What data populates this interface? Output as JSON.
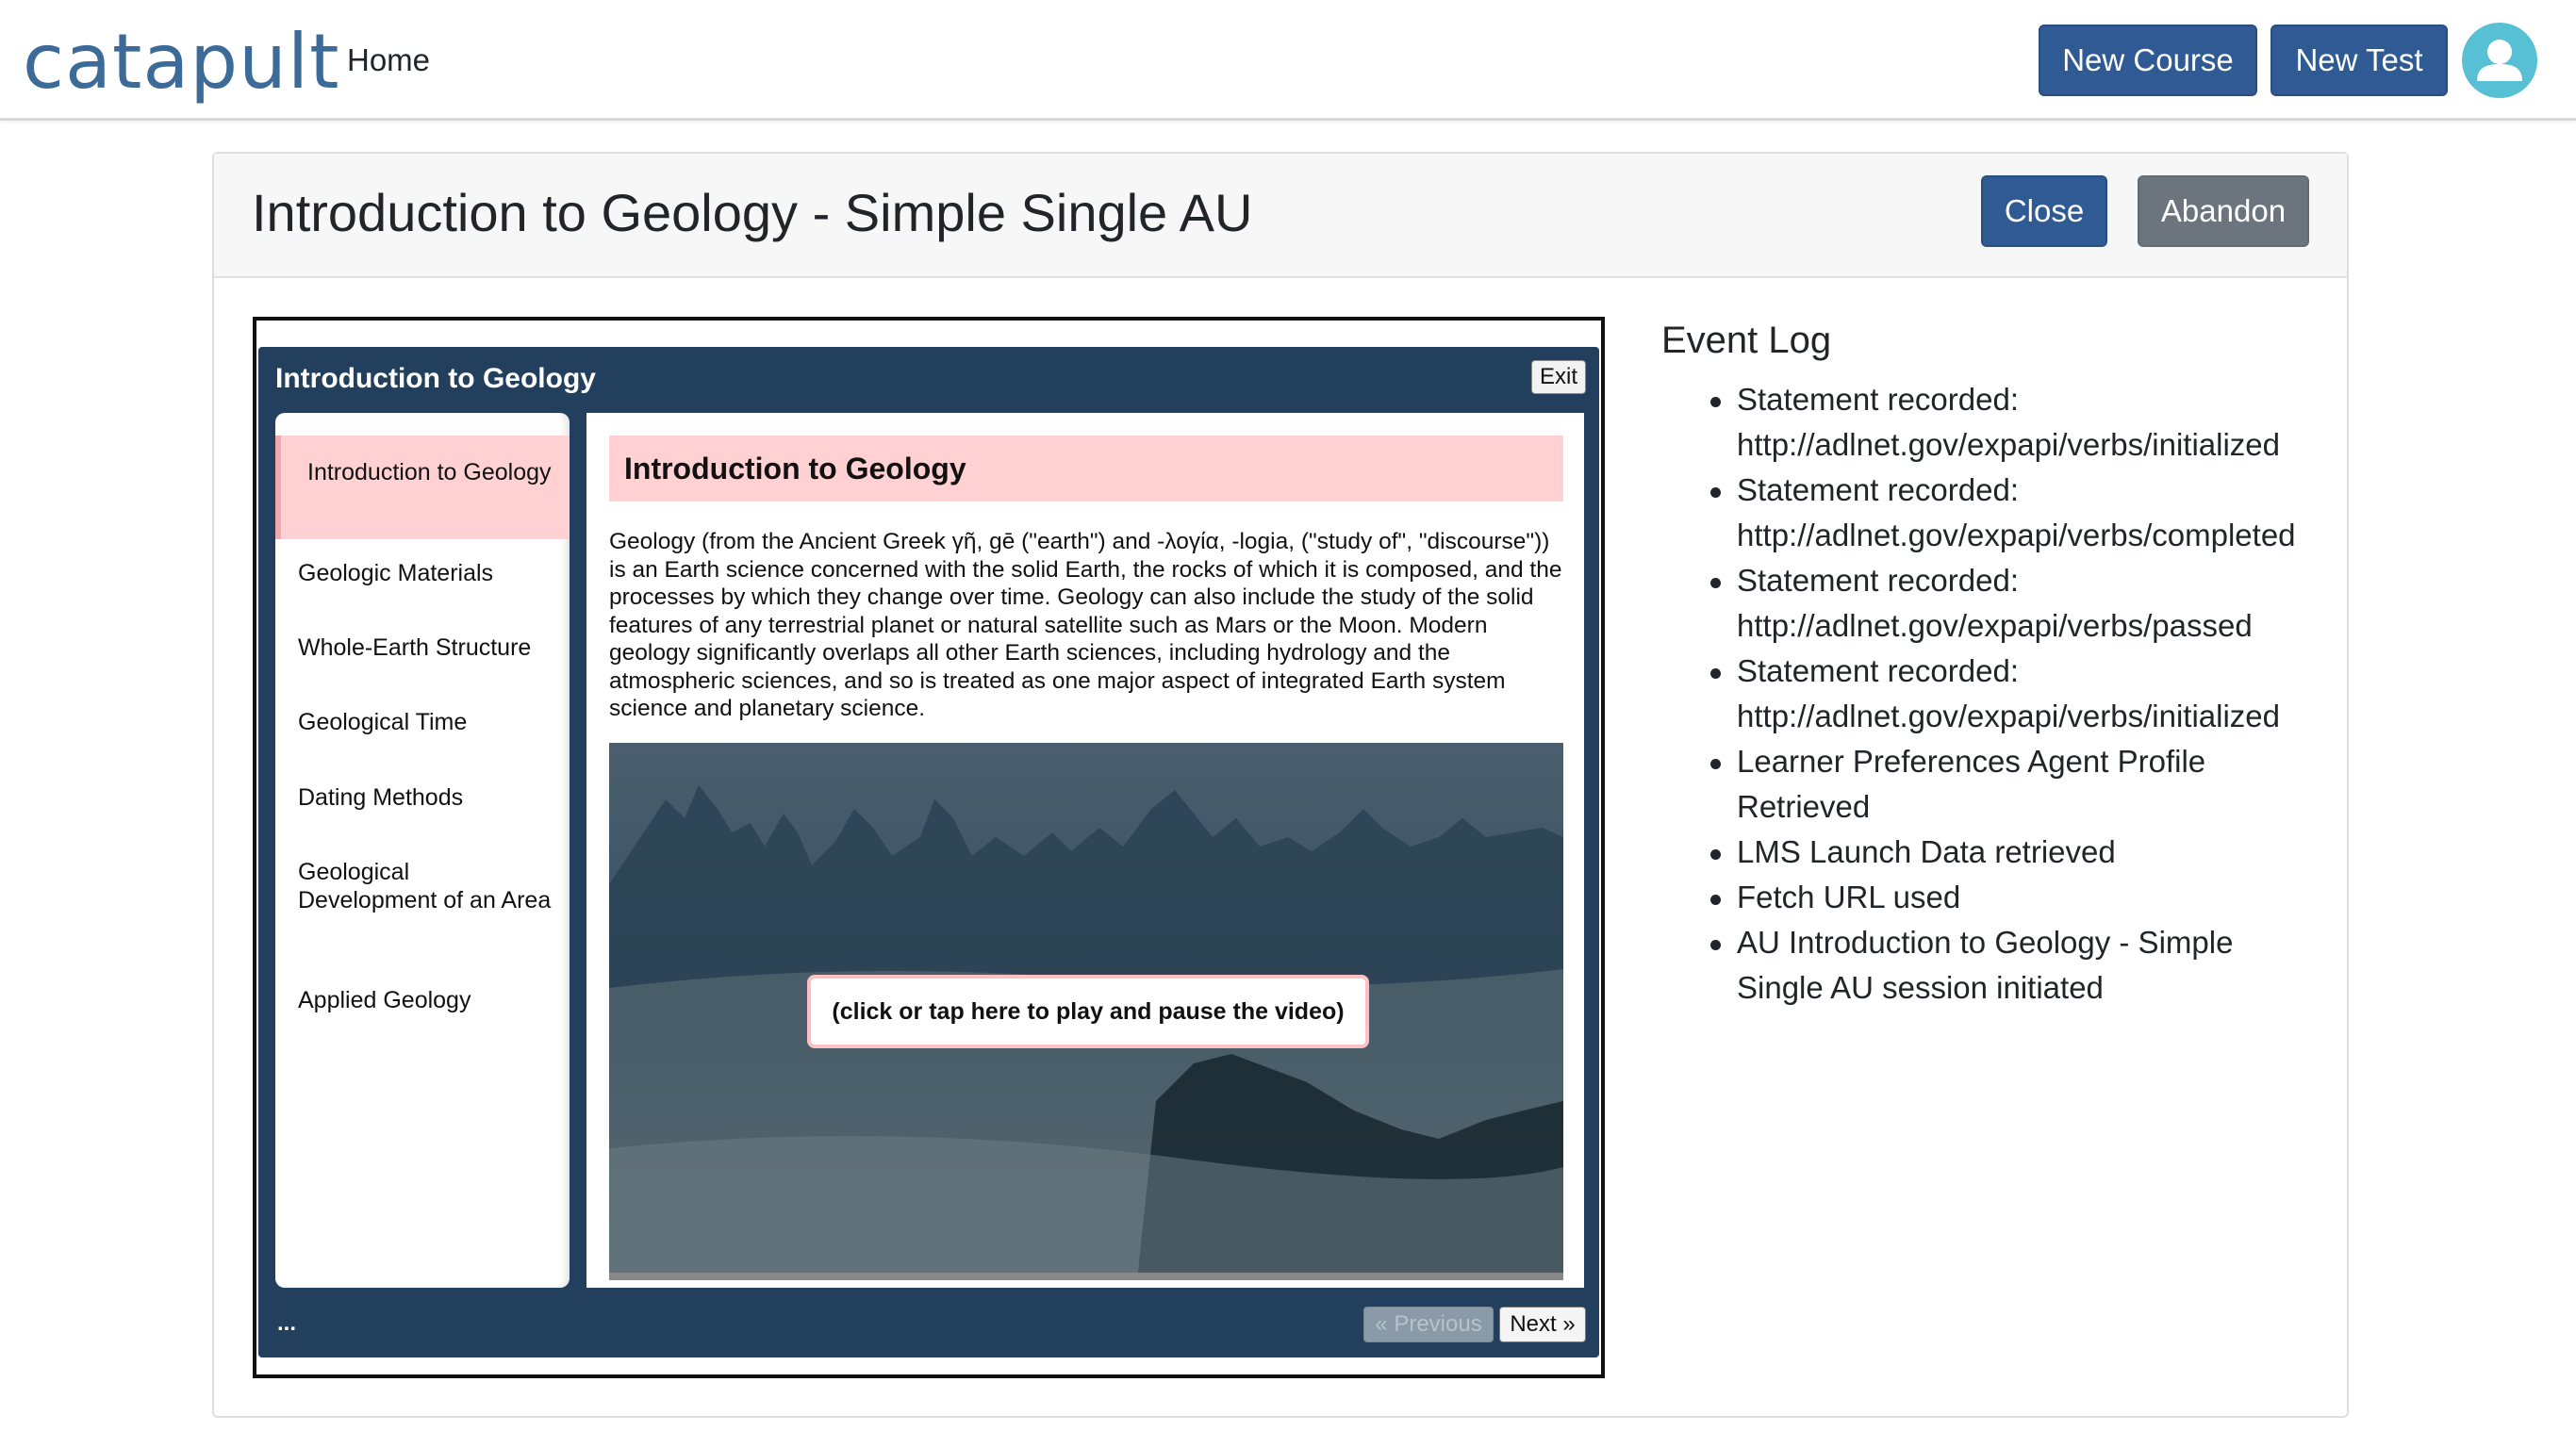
{
  "nav": {
    "brand": "catapult",
    "home_label": "Home",
    "new_course_label": "New Course",
    "new_test_label": "New Test",
    "avatar_icon": "user-avatar-icon"
  },
  "page": {
    "title": "Introduction to Geology - Simple Single AU",
    "close_label": "Close",
    "abandon_label": "Abandon"
  },
  "player": {
    "title": "Introduction to Geology",
    "exit_label": "Exit",
    "sidebar_items": [
      {
        "label": "Introduction to Geology",
        "active": true
      },
      {
        "label": "Geologic Materials",
        "active": false
      },
      {
        "label": "Whole-Earth Structure",
        "active": false
      },
      {
        "label": "Geological Time",
        "active": false
      },
      {
        "label": "Dating Methods",
        "active": false
      },
      {
        "label": "Geological Development of an Area",
        "active": false
      },
      {
        "label": "Applied Geology",
        "active": false
      }
    ],
    "content_heading": "Introduction to Geology",
    "content_text": "Geology (from the Ancient Greek γῆ, gē (\"earth\") and -λογία, -logia, (\"study of\", \"discourse\")) is an Earth science concerned with the solid Earth, the rocks of which it is composed, and the processes by which they change over time. Geology can also include the study of the solid features of any terrestrial planet or natural satellite such as Mars or the Moon. Modern geology significantly overlaps all other Earth sciences, including hydrology and the atmospheric sciences, and so is treated as one major aspect of integrated Earth system science and planetary science.",
    "video_overlay": "(click or tap here to play and pause the video)",
    "footer_dots": "...",
    "previous_label": "« Previous",
    "next_label": "Next »"
  },
  "event_log": {
    "title": "Event Log",
    "items": [
      "Statement recorded: http://adlnet.gov/expapi/verbs/initialized",
      "Statement recorded: http://adlnet.gov/expapi/verbs/completed",
      "Statement recorded: http://adlnet.gov/expapi/verbs/passed",
      "Statement recorded: http://adlnet.gov/expapi/verbs/initialized",
      "Learner Preferences Agent Profile Retrieved",
      "LMS Launch Data retrieved",
      "Fetch URL used",
      "AU Introduction to Geology - Simple Single AU session initiated"
    ]
  },
  "colors": {
    "brand": "#3d6b99",
    "primary": "#2f5a93",
    "secondary": "#6c757d",
    "player_bg": "#22405e",
    "highlight": "#ffd1d3",
    "avatar": "#58c0d4"
  }
}
